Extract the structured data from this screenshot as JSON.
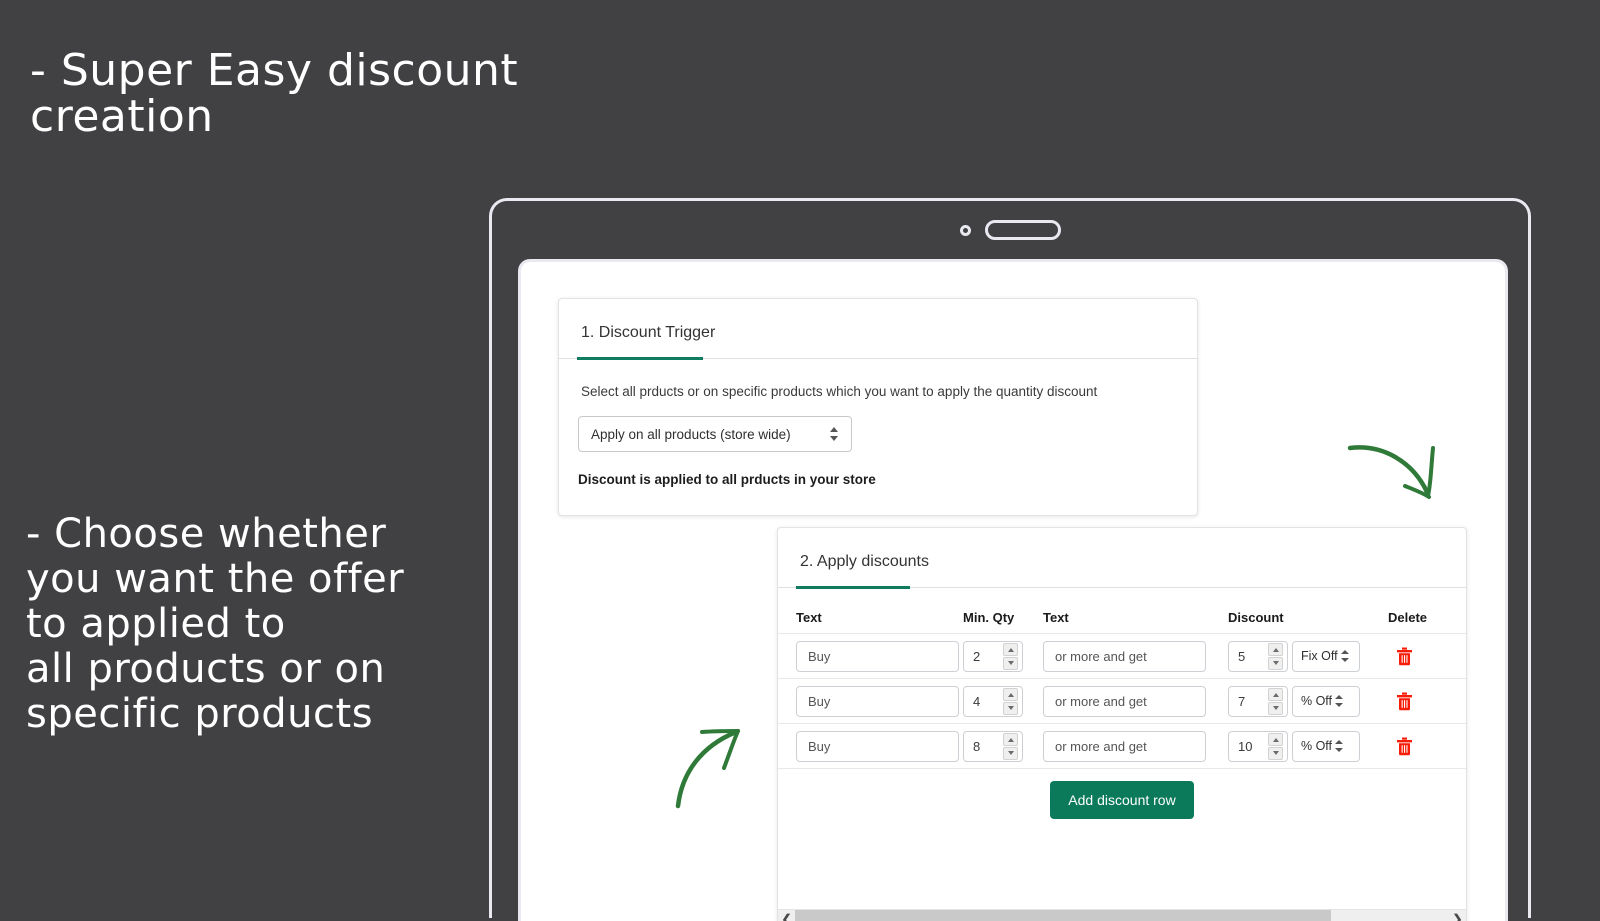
{
  "promo": {
    "heading": "- Super Easy discount\ncreation",
    "body": "- Choose whether\nyou want the offer\nto applied to\nall products or on\nspecific products"
  },
  "device": {
    "camera_icon": "camera-dot-icon",
    "speaker_icon": "speaker-slot-icon"
  },
  "annotations": {
    "arrow_to_trigger": "curved-arrow-down-right-icon",
    "arrow_to_table": "curved-arrow-up-right-icon",
    "accent_color": "#0f7b5f"
  },
  "trigger_card": {
    "title": "1. Discount Trigger",
    "description": "Select all prducts or on specific products which you want to apply the quantity discount",
    "select_value": "Apply on all products (store wide)",
    "select_icon": "updown-arrows-icon",
    "note": "Discount is applied to all prducts in your store"
  },
  "apply_card": {
    "title": "2. Apply discounts",
    "columns": [
      "Text",
      "Min. Qty",
      "Text",
      "Discount",
      "Delete"
    ],
    "rows": [
      {
        "text1": "Buy",
        "qty": "2",
        "text2": "or more and get",
        "discount": "5",
        "unit": "Fix Off",
        "delete_icon": "trash-icon"
      },
      {
        "text1": "Buy",
        "qty": "4",
        "text2": "or more and get",
        "discount": "7",
        "unit": "% Off",
        "delete_icon": "trash-icon"
      },
      {
        "text1": "Buy",
        "qty": "8",
        "text2": "or more and get",
        "discount": "10",
        "unit": "% Off",
        "delete_icon": "trash-icon"
      }
    ],
    "add_button": "Add discount row",
    "add_button_color": "#0b7a5a",
    "delete_color": "#f81d09",
    "scroll_left_icon": "chevron-left-icon",
    "scroll_right_icon": "chevron-right-icon"
  }
}
